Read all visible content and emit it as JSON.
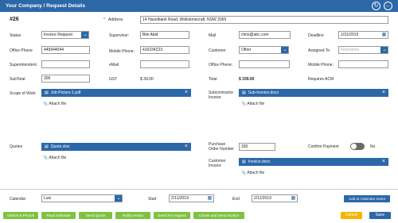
{
  "header": {
    "title": "Your Company / Request Details",
    "refresh_icon": "refresh-icon",
    "back_icon": "back-arrow-icon"
  },
  "request": {
    "number": "#26"
  },
  "address": {
    "label": "Address",
    "required_mark": "*",
    "value": "14 Hazelbank Road, Wollstonecraft, NSW 2065"
  },
  "status": {
    "label": "Status",
    "value": "Invoice Request"
  },
  "supervisor": {
    "label": "Supervisor:",
    "value": "Bile Abid"
  },
  "mail": {
    "label": "Mail",
    "value": "chris@abc.com"
  },
  "deadline": {
    "label": "Deadline",
    "value": "1/31/2019"
  },
  "office_phone": {
    "label": "Office Phone",
    "value": "449944044"
  },
  "mobile_phone": {
    "label": "Mobile Phone:",
    "value": "416234223"
  },
  "customer": {
    "label": "Customer",
    "value": "Other"
  },
  "assigned_to": {
    "label": "Assigned To",
    "placeholder": "Find items"
  },
  "superintendent": {
    "label": "Superintendent",
    "value": ""
  },
  "email": {
    "label": "eMail",
    "value": ""
  },
  "customer_office_phone": {
    "label": "Office Phone:",
    "value": ""
  },
  "customer_mobile_phone": {
    "label": "Mobile Phone:",
    "value": ""
  },
  "subtotal": {
    "label": "SubTotal",
    "value": "300"
  },
  "gst": {
    "label": "GST",
    "value": "$ 39.00"
  },
  "total": {
    "label": "Total",
    "value": "$ 339.00"
  },
  "requires_acm": {
    "label": "Requires ACM"
  },
  "scope_of_work": {
    "label": "Scope of Work",
    "file": "Job Picture 1.pdf",
    "attach": "Attach file"
  },
  "subcontractor_invoice": {
    "label_line1": "Subcontractor",
    "label_line2": "Invoice",
    "file": "Sub-Invoice.docx",
    "attach": "Attach file"
  },
  "quotes": {
    "label": "Quotes",
    "file": "Quote.xlsx",
    "attach": "Attach file"
  },
  "purchase_order": {
    "label_line1": "Purchase",
    "label_line2": "Order Number",
    "value": "330"
  },
  "confirm_payment": {
    "label": "Confirm Payment",
    "state": "No",
    "on": false
  },
  "customer_invoice": {
    "label_line1": "Customer",
    "label_line2": "Invoice",
    "file": "Invoice.docx",
    "attach": "Attach file"
  },
  "calendar": {
    "label": "Calendar",
    "value": "Luis"
  },
  "start": {
    "label": "Start",
    "value": "2/11/2019"
  },
  "end": {
    "label": "End",
    "value": "2/11/2019"
  },
  "add_calendar_button": "Add to Calendar event",
  "footer_buttons": [
    "Videos & Photos",
    "Read Estimate",
    "Send Quote",
    "Notify tenant",
    "Send PO request",
    "Create and Send Invoice"
  ],
  "cancel_button": "Cancel",
  "save_button": "Save",
  "colors": {
    "primary": "#2c67a8",
    "green": "#7fc241",
    "yellow": "#f5b400"
  }
}
